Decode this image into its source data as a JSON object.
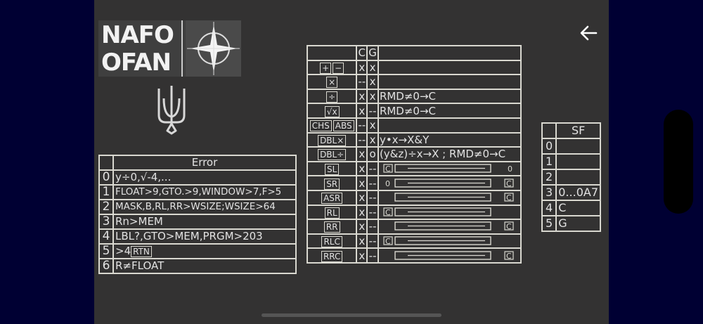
{
  "logo": {
    "line1": "NAFO",
    "line2": "OFAN"
  },
  "errors": {
    "header": "Error",
    "rows": [
      {
        "num": "0",
        "text": "y÷0,√-4,..."
      },
      {
        "num": "1",
        "text": "FLOAT>9,GTO.>9,WINDOW>7,F>5"
      },
      {
        "num": "2",
        "text": "MASK,B,RL,RR>WSIZE;WSIZE>64"
      },
      {
        "num": "3",
        "text": "Rn>MEM"
      },
      {
        "num": "4",
        "text": "LBL?,GTO>MEM,PRGM>203"
      },
      {
        "num": "5",
        "text": ">4",
        "key": "RTN"
      },
      {
        "num": "6",
        "text": "R≠FLOAT"
      }
    ]
  },
  "ops": {
    "col_c": "C",
    "col_g": "G",
    "rows": [
      {
        "keys": [
          "+",
          "−"
        ],
        "c": "x",
        "g": "x",
        "desc": ""
      },
      {
        "keys": [
          "×"
        ],
        "c": "--",
        "g": "x",
        "desc": ""
      },
      {
        "keys": [
          "÷"
        ],
        "c": "x",
        "g": "x",
        "desc": "RMD≠0→C"
      },
      {
        "keys": [
          "√x"
        ],
        "c": "x",
        "g": "--",
        "desc": "RMD≠0→C"
      },
      {
        "keys": [
          "CHS",
          "ABS"
        ],
        "c": "--",
        "g": "x",
        "desc": ""
      },
      {
        "keys": [
          "DBL×"
        ],
        "c": "--",
        "g": "x",
        "desc": "y•x→X&Y"
      },
      {
        "keys": [
          "DBL÷"
        ],
        "c": "x",
        "g": "o",
        "desc": "(y&z)÷x→X ; RMD≠0→C"
      },
      {
        "keys": [
          "SL"
        ],
        "c": "x",
        "g": "--",
        "diagram": "sl"
      },
      {
        "keys": [
          "SR"
        ],
        "c": "x",
        "g": "--",
        "diagram": "sr"
      },
      {
        "keys": [
          "ASR"
        ],
        "c": "x",
        "g": "--",
        "diagram": "asr"
      },
      {
        "keys": [
          "RL"
        ],
        "c": "x",
        "g": "--",
        "diagram": "rl"
      },
      {
        "keys": [
          "RR"
        ],
        "c": "x",
        "g": "--",
        "diagram": "rr"
      },
      {
        "keys": [
          "RLC"
        ],
        "c": "x",
        "g": "--",
        "diagram": "rlc"
      },
      {
        "keys": [
          "RRC"
        ],
        "c": "x",
        "g": "--",
        "diagram": "rrc"
      }
    ],
    "diagram_labels": {
      "carry": "C",
      "zero": "0"
    }
  },
  "flags": {
    "header": "SF",
    "rows": [
      {
        "num": "0",
        "text": ""
      },
      {
        "num": "1",
        "text": ""
      },
      {
        "num": "2",
        "text": ""
      },
      {
        "num": "3",
        "text": "0...0A7"
      },
      {
        "num": "4",
        "text": "C"
      },
      {
        "num": "5",
        "text": "G"
      }
    ]
  },
  "icons": {
    "back": "back-arrow-icon"
  },
  "colors": {
    "screen_bg": "#333232",
    "outer_bg": "#000033",
    "lines": "#d9d8d0"
  }
}
